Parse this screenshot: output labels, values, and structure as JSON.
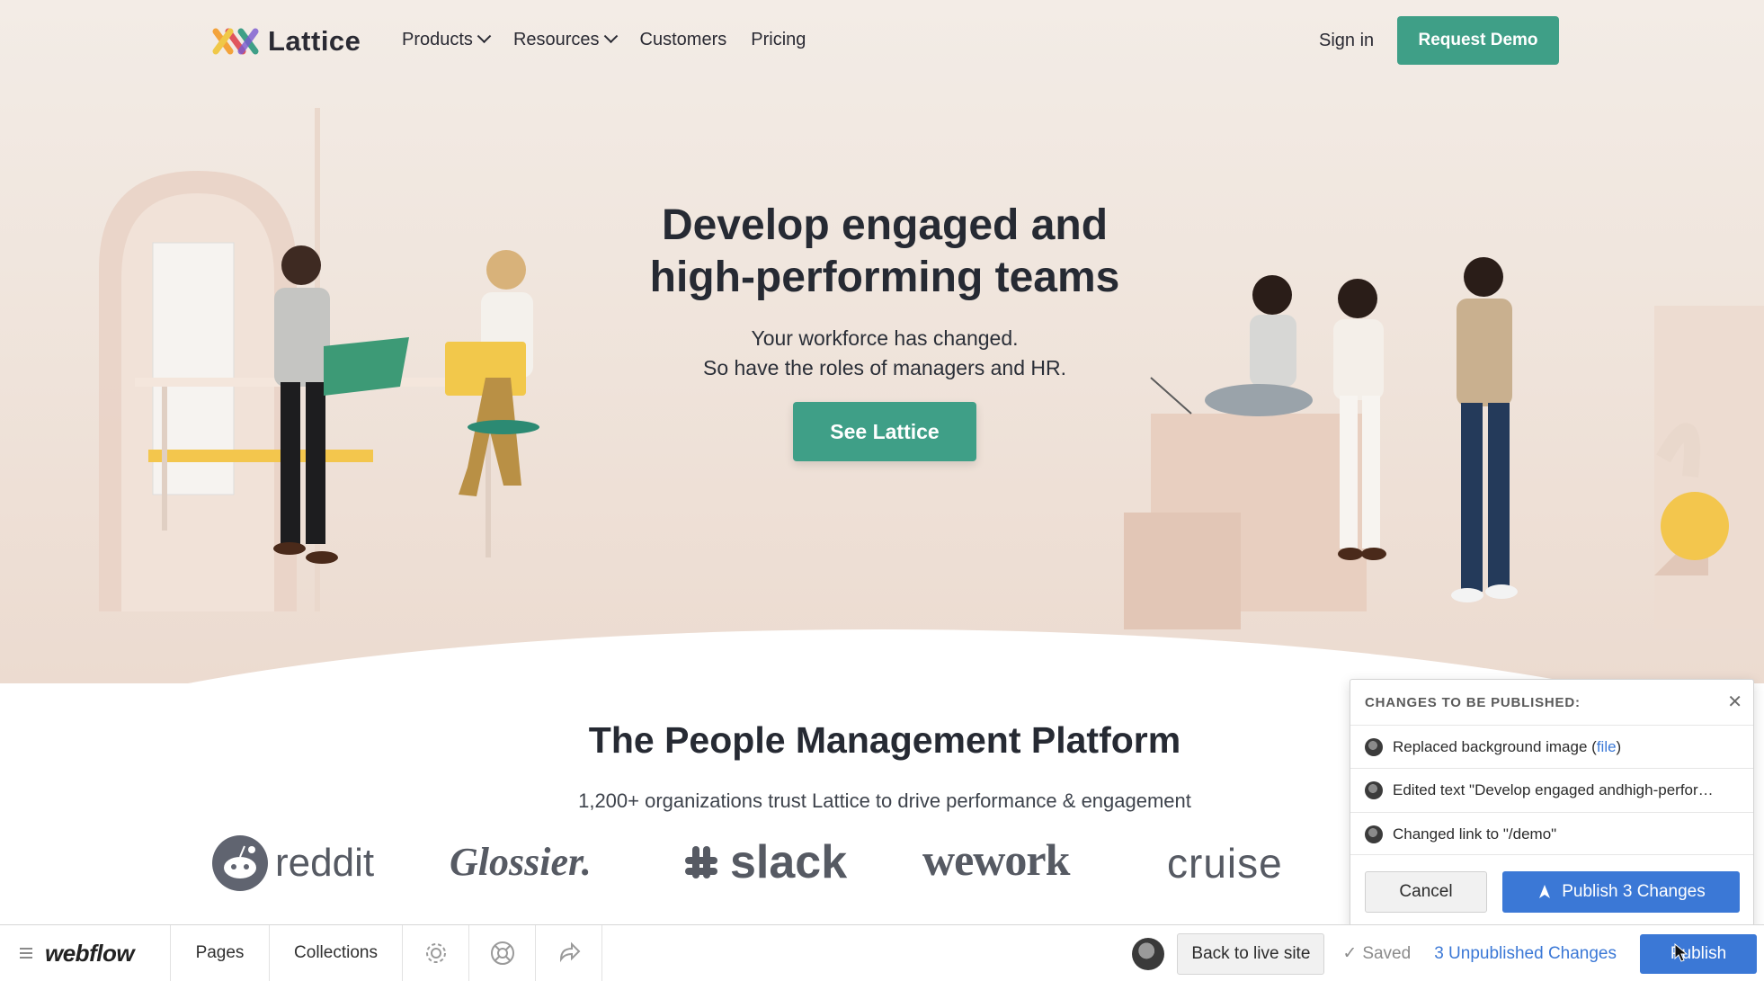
{
  "site": {
    "brand": "Lattice",
    "nav": [
      {
        "label": "Products",
        "has_dropdown": true
      },
      {
        "label": "Resources",
        "has_dropdown": true
      },
      {
        "label": "Customers",
        "has_dropdown": false
      },
      {
        "label": "Pricing",
        "has_dropdown": false
      }
    ],
    "sign_in": "Sign in",
    "request_demo": "Request Demo",
    "hero": {
      "headline_line1": "Develop engaged and",
      "headline_line2": "high-performing teams",
      "subline1": "Your workforce has changed.",
      "subline2": "So have the roles of managers and HR.",
      "cta": "See Lattice"
    },
    "platform": {
      "title": "The People Management Platform",
      "subtitle": "1,200+ organizations trust Lattice to drive performance & engagement",
      "customer_logos": [
        "reddit",
        "Glossier.",
        "slack",
        "wework",
        "cruise"
      ]
    },
    "colors": {
      "accent": "#3f9f87",
      "hero_bg": "#efe3da",
      "text": "#262a33"
    }
  },
  "webflow": {
    "logo": "webflow",
    "pages": "Pages",
    "collections": "Collections",
    "tool_icons": [
      "gear-icon",
      "help-icon",
      "share-icon"
    ],
    "back_to_live": "Back to live site",
    "saved": "Saved",
    "unpublished": "3 Unpublished Changes",
    "publish": "Publish",
    "colors": {
      "primary": "#3b78d6"
    }
  },
  "popover": {
    "title": "CHANGES TO BE PUBLISHED:",
    "changes": [
      {
        "prefix": "Replaced background image (",
        "link": "file",
        "suffix": ")"
      },
      {
        "text": "Edited text \"Develop engaged andhigh-perfor…"
      },
      {
        "text": "Changed link to \"/demo\""
      }
    ],
    "cancel": "Cancel",
    "publish_changes": "Publish 3 Changes"
  }
}
